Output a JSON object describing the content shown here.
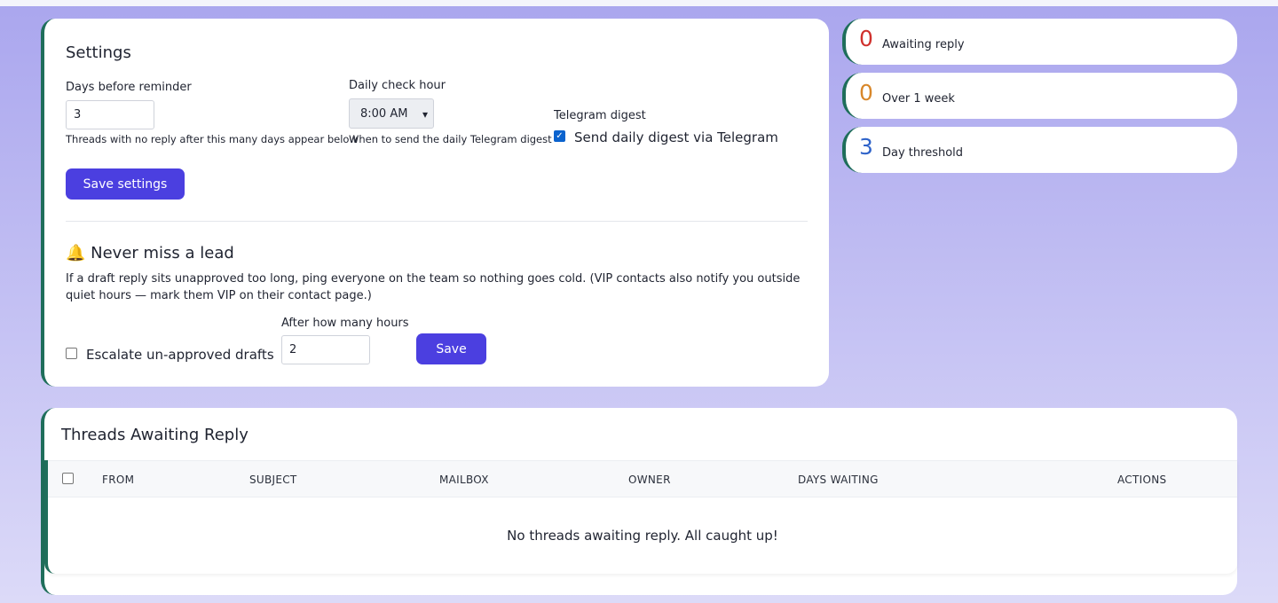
{
  "settings": {
    "title": "Settings",
    "days_label": "Days before reminder",
    "days_value": "3",
    "days_hint": "Threads with no reply after this many days appear below",
    "hour_label": "Daily check hour",
    "hour_value": "8:00 AM",
    "hour_hint": "When to send the daily Telegram digest",
    "telegram_label": "Telegram digest",
    "telegram_checkbox": "Send daily digest via Telegram",
    "telegram_checked": true,
    "save_label": "Save settings"
  },
  "escalation": {
    "title": "🔔 Never miss a lead",
    "description": "If a draft reply sits unapproved too long, ping everyone on the team so nothing goes cold. (VIP contacts also notify you outside quiet hours — mark them VIP on their contact page.)",
    "checkbox_label": "Escalate un-approved drafts",
    "checked": false,
    "hours_label": "After how many hours",
    "hours_value": "2",
    "save_label": "Save"
  },
  "stats": [
    {
      "value": "0",
      "label": "Awaiting reply",
      "color": "#d0312d"
    },
    {
      "value": "0",
      "label": "Over 1 week",
      "color": "#d8872a"
    },
    {
      "value": "3",
      "label": "Day threshold",
      "color": "#2f63c9"
    }
  ],
  "threads": {
    "title": "Threads Awaiting Reply",
    "columns": [
      "FROM",
      "SUBJECT",
      "MAILBOX",
      "OWNER",
      "DAYS WAITING",
      "ACTIONS"
    ],
    "empty_message": "No threads awaiting reply. All caught up!"
  }
}
